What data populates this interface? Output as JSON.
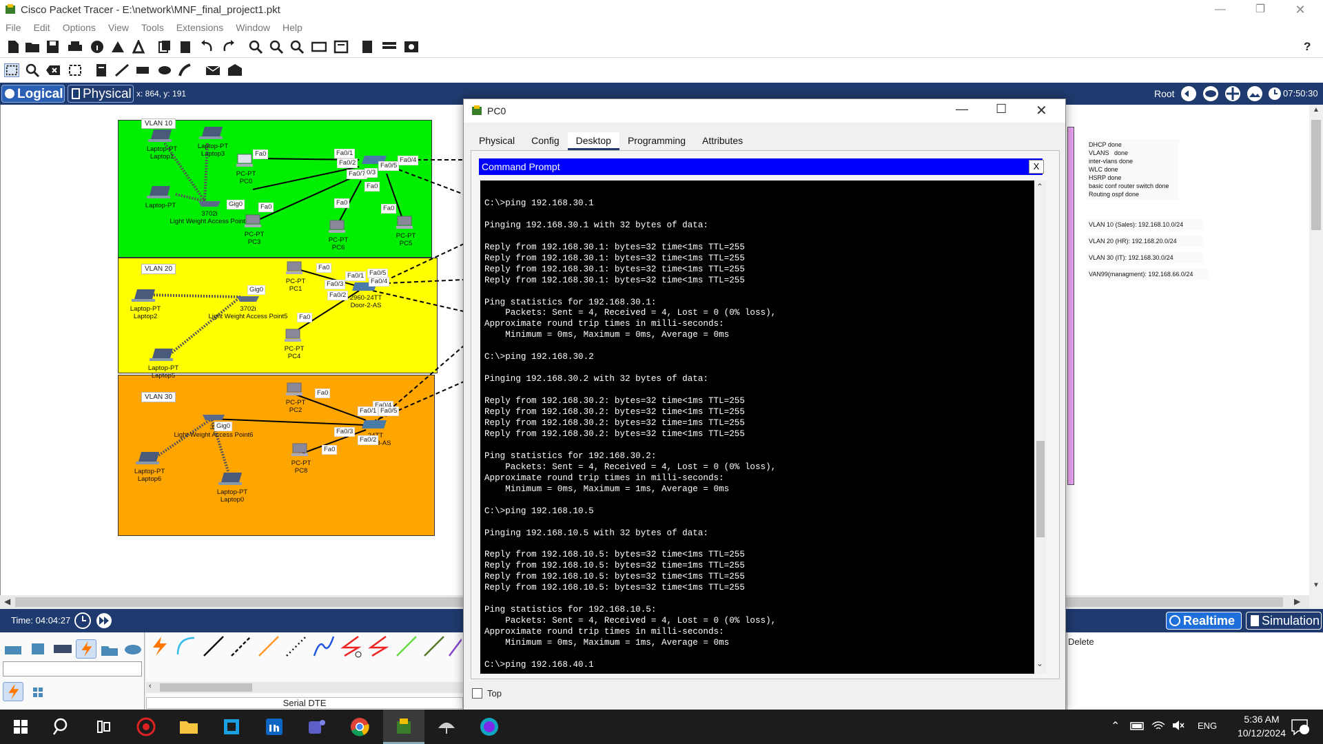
{
  "window": {
    "title": "Cisco Packet Tracer - E:\\network\\MNF_final_project1.pkt"
  },
  "menu": [
    "File",
    "Edit",
    "Options",
    "View",
    "Tools",
    "Extensions",
    "Window",
    "Help"
  ],
  "toolbar": {
    "help_label": "?"
  },
  "view_tabs": {
    "logical": "Logical",
    "physical": "Physical",
    "coords": "x: 864, y: 191",
    "root": "Root",
    "clock": "07:50:30"
  },
  "canvas": {
    "vlans": [
      {
        "label": "VLAN 10",
        "color": "#00ee00"
      },
      {
        "label": "VLAN 20",
        "color": "#ffff00"
      },
      {
        "label": "VLAN 30",
        "color": "#ffa500"
      }
    ],
    "devices": [
      {
        "name": "Laptop-PT\nLaptop1"
      },
      {
        "name": "Laptop-PT\nLaptop3"
      },
      {
        "name": "PC-PT\nPC0"
      },
      {
        "name": "Laptop-PT\nLaptop4"
      },
      {
        "name": "3702i\nLight Weight Access Point4"
      },
      {
        "name": "PC-PT\nPC3"
      },
      {
        "name": "PC-PT\nPC6"
      },
      {
        "name": "PC-PT\nPC5"
      },
      {
        "name": "PC-PT\nPC1"
      },
      {
        "name": "Laptop-PT\nLaptop2"
      },
      {
        "name": "3702i\nLight Weight Access Point5"
      },
      {
        "name": "2960-24TT\nDoor-2-AS"
      },
      {
        "name": "PC-PT\nPC4"
      },
      {
        "name": "Laptop-PT\nLaptop5"
      },
      {
        "name": "PC-PT\nPC2"
      },
      {
        "name": "37\nLight Weight Access Point6"
      },
      {
        "name": "24TT\nDoor-3-AS"
      },
      {
        "name": "PC-PT\nPC8"
      },
      {
        "name": "Laptop-PT\nLaptop6"
      },
      {
        "name": "Laptop-PT\nLaptop0"
      }
    ],
    "ports": [
      "Fa0",
      "Fa0/1",
      "Fa0/2",
      "Fa0/4",
      "Fa0/5",
      "Fa0/7",
      "0/3",
      "Gig0",
      "Fa0",
      "Fa0",
      "Fa0",
      "Fa0",
      "Fa0",
      "Fa0/1",
      "Fa0/3",
      "Fa0/2",
      "Fa0/5",
      "Fa0/4",
      "Gig0",
      "Fa0",
      "Fa0",
      "Fa0/4",
      "Fa0/1",
      "Fa0/5",
      "Fa0/3",
      "Fa0/2",
      "Fa0",
      "Gig0"
    ],
    "notes": [
      "DHCP done\nVLANS   done\ninter-vlans done\nWLC done\nHSRP done\nbasic conf router switch done\nRouting ospf done",
      "VLAN 10 (Sales): 192.168.10.0/24",
      "VLAN 20 (HR): 192.168.20.0/24",
      "VLAN 30 (IT): 192.168.30.0/24",
      "VAN99(managment): 192.168.66.0/24"
    ]
  },
  "dialog": {
    "title": "PC0",
    "tabs": [
      "Physical",
      "Config",
      "Desktop",
      "Programming",
      "Attributes"
    ],
    "active_tab": "Desktop",
    "cmd_title": "Command Prompt",
    "cmd_close": "X",
    "terminal_text": "\nC:\\>ping 192.168.30.1\n\nPinging 192.168.30.1 with 32 bytes of data:\n\nReply from 192.168.30.1: bytes=32 time<1ms TTL=255\nReply from 192.168.30.1: bytes=32 time<1ms TTL=255\nReply from 192.168.30.1: bytes=32 time<1ms TTL=255\nReply from 192.168.30.1: bytes=32 time<1ms TTL=255\n\nPing statistics for 192.168.30.1:\n    Packets: Sent = 4, Received = 4, Lost = 0 (0% loss),\nApproximate round trip times in milli-seconds:\n    Minimum = 0ms, Maximum = 0ms, Average = 0ms\n\nC:\\>ping 192.168.30.2\n\nPinging 192.168.30.2 with 32 bytes of data:\n\nReply from 192.168.30.2: bytes=32 time<1ms TTL=255\nReply from 192.168.30.2: bytes=32 time<1ms TTL=255\nReply from 192.168.30.2: bytes=32 time=1ms TTL=255\nReply from 192.168.30.2: bytes=32 time<1ms TTL=255\n\nPing statistics for 192.168.30.2:\n    Packets: Sent = 4, Received = 4, Lost = 0 (0% loss),\nApproximate round trip times in milli-seconds:\n    Minimum = 0ms, Maximum = 1ms, Average = 0ms\n\nC:\\>ping 192.168.10.5\n\nPinging 192.168.10.5 with 32 bytes of data:\n\nReply from 192.168.10.5: bytes=32 time<1ms TTL=255\nReply from 192.168.10.5: bytes=32 time=1ms TTL=255\nReply from 192.168.10.5: bytes=32 time<1ms TTL=255\nReply from 192.168.10.5: bytes=32 time<1ms TTL=255\n\nPing statistics for 192.168.10.5:\n    Packets: Sent = 4, Received = 4, Lost = 0 (0% loss),\nApproximate round trip times in milli-seconds:\n    Minimum = 0ms, Maximum = 1ms, Average = 0ms\n\nC:\\>ping 192.168.40.1",
    "top_label": "Top"
  },
  "bottom": {
    "time_label": "Time: 04:04:27",
    "realtime": "Realtime",
    "simulation": "Simulation",
    "connection_name": "Serial DTE",
    "delete_label": "Delete",
    "device_search_value": ""
  },
  "taskbar": {
    "lang": "ENG",
    "time": "5:36 AM",
    "date": "10/12/2024"
  }
}
